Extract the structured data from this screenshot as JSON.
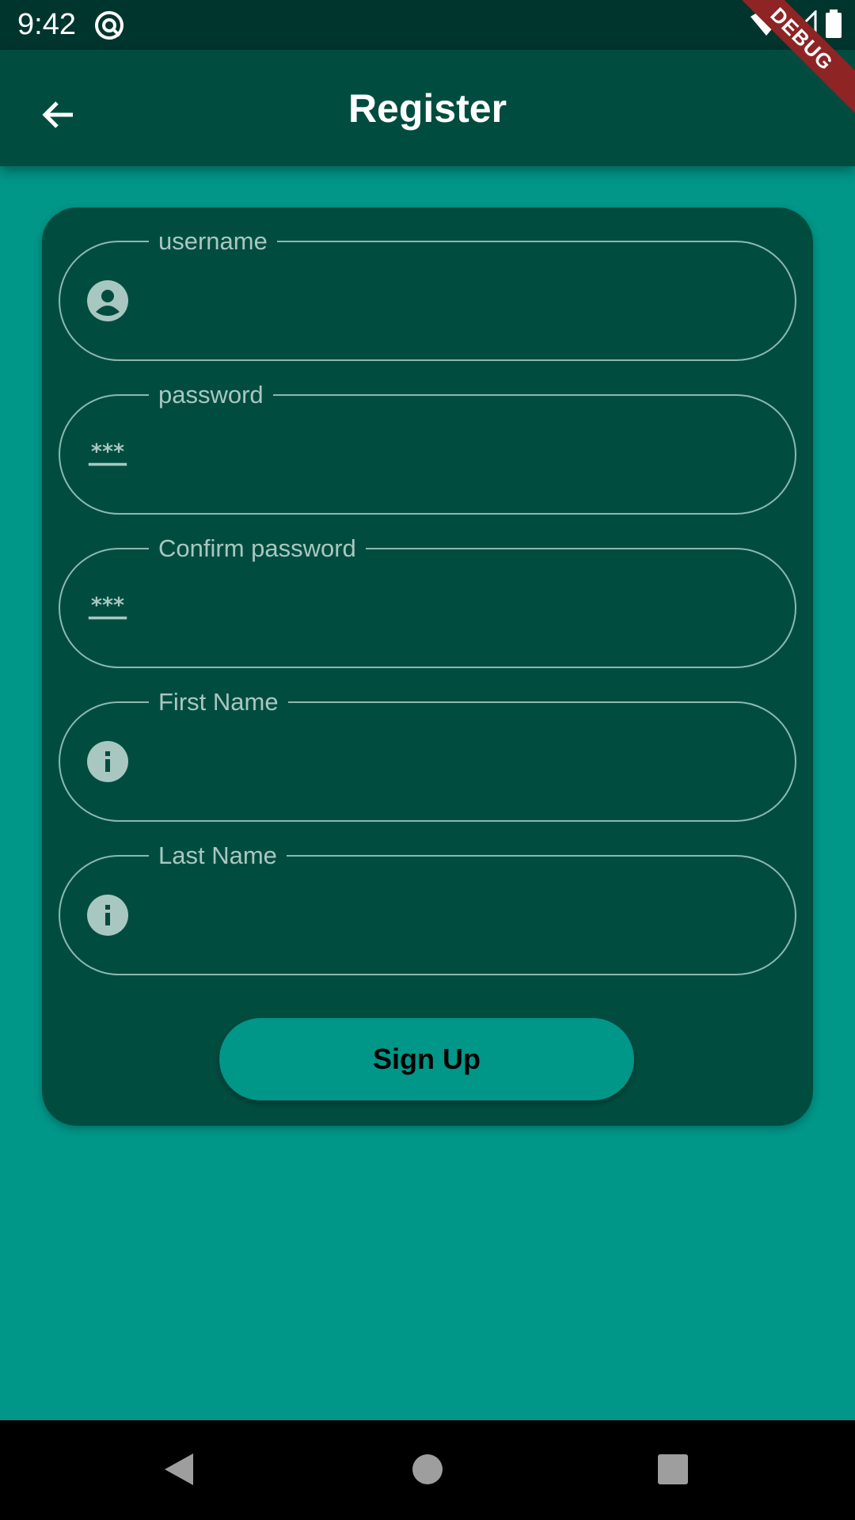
{
  "status_bar": {
    "time": "9:42"
  },
  "app_bar": {
    "title": "Register",
    "back_icon": "arrow-back-icon"
  },
  "debug_banner": {
    "text": "DEBUG"
  },
  "form": {
    "fields": [
      {
        "label": "username",
        "icon": "account-circle-icon",
        "value": ""
      },
      {
        "label": "password",
        "icon": "password-icon",
        "value": ""
      },
      {
        "label": "Confirm password",
        "icon": "password-icon",
        "value": ""
      },
      {
        "label": "First Name",
        "icon": "info-icon",
        "value": ""
      },
      {
        "label": "Last Name",
        "icon": "info-icon",
        "value": ""
      }
    ],
    "submit_label": "Sign Up"
  },
  "colors": {
    "background": "#009688",
    "card": "#004D40",
    "app_bar": "#004D40",
    "status_bar": "#00352E",
    "field_border": "#8DB8B0",
    "button": "#009688",
    "debug_banner": "#8E2424"
  },
  "nav_bar": {
    "back_icon": "nav-back-icon",
    "home_icon": "nav-home-icon",
    "recents_icon": "nav-recents-icon"
  }
}
